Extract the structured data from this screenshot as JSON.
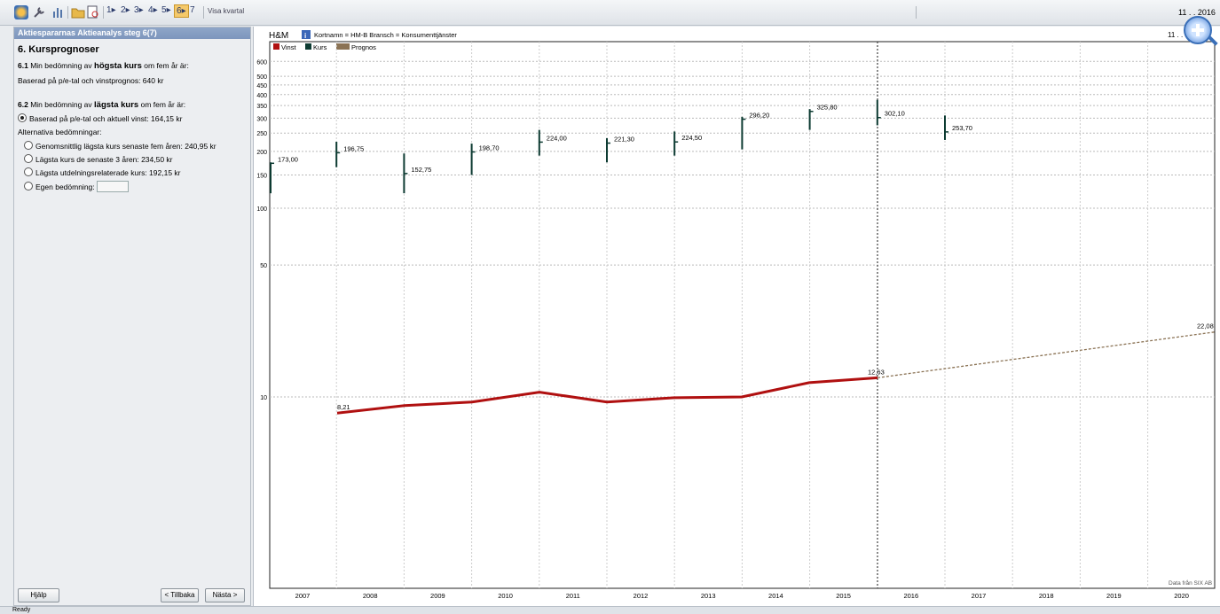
{
  "toolbar": {
    "steps": [
      "1",
      "2",
      "3",
      "4",
      "5",
      "6",
      "7"
    ],
    "visa_kvartal": "Visa kvartal",
    "date": "11 . . 2016"
  },
  "panel": {
    "header": "Aktiespararnas Aktieanalys steg 6(7)",
    "title": "6. Kursprognoser",
    "q1_num": "6.1",
    "q1_pre": "Min bedömning av",
    "q1_bold": "högsta kurs",
    "q1_post": "om fem år är:",
    "q1_basis": "Baserad på p/e-tal och vinstprognos: 640 kr",
    "q2_num": "6.2",
    "q2_pre": "Min bedömning av",
    "q2_bold": "lägsta kurs",
    "q2_post": "om fem år är:",
    "q2_basis": "Baserad på p/e-tal och aktuell vinst: 164,15 kr",
    "alt_label": "Alternativa bedömningar:",
    "options": [
      "Genomsnittlig lägsta kurs senaste fem åren: 240,95 kr",
      "Lägsta kurs de senaste 3 åren: 234,50 kr",
      "Lägsta utdelningsrelaterade kurs: 192,15 kr",
      "Egen bedömning:"
    ],
    "buttons": {
      "help": "Hjälp",
      "back": "< Tillbaka",
      "next": "Nästa >"
    }
  },
  "chart_header": {
    "name": "H&M",
    "info": "Kortnamn = HM-B  Bransch = Konsumenttjänster",
    "date_right": "11 . . 16"
  },
  "colors": {
    "vinst": "#b01010",
    "kurs": "#0d3b32",
    "prognos": "#8b7355",
    "panel_header": "#8fa6c8"
  },
  "chart_data": {
    "type": "line",
    "legend": [
      "Vinst",
      "Kurs",
      "Prognos"
    ],
    "y_scale": "log",
    "y_ticks": [
      10,
      50,
      100,
      150,
      200,
      250,
      300,
      350,
      400,
      450,
      500,
      600
    ],
    "x_categories": [
      "2007",
      "2008",
      "2009",
      "2010",
      "2011",
      "2012",
      "2013",
      "2014",
      "2015",
      "2016",
      "2017",
      "2018",
      "2019",
      "2020"
    ],
    "kurs_labels": [
      "173,00",
      "196,75",
      "152,75",
      "198,70",
      "224,00",
      "221,30",
      "224,50",
      "296,20",
      "325,80",
      "302,10",
      "253,70"
    ],
    "vinst_labels": {
      "start": "8,21",
      "end": "12,63",
      "prognos_end": "22,08"
    },
    "footer": "Data från SIX AB"
  },
  "statusbar": {
    "text": "Ready"
  }
}
